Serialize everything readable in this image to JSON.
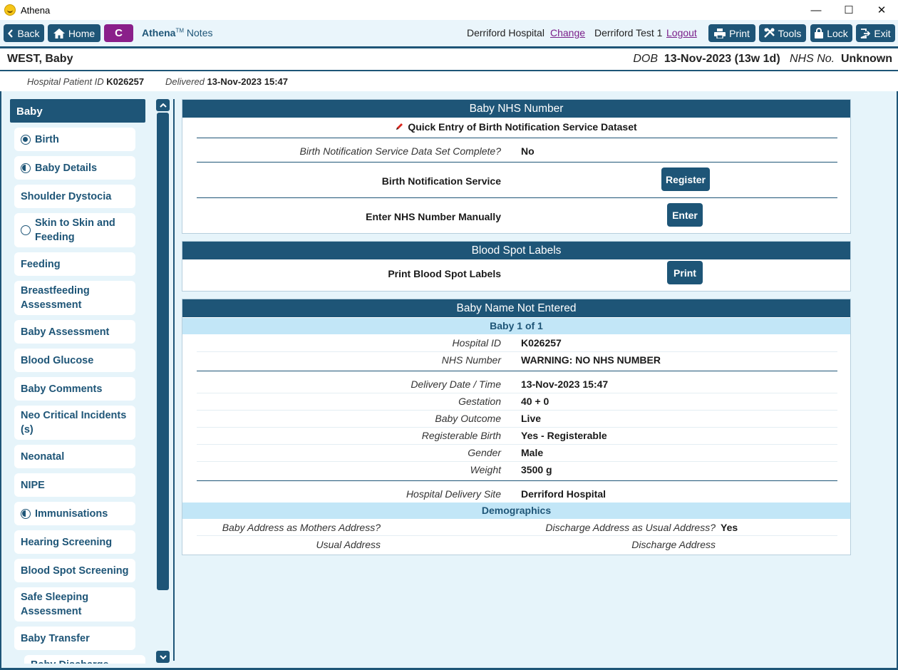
{
  "window": {
    "title": "Athena",
    "minimize": "—",
    "maximize": "☐",
    "close": "✕"
  },
  "toolbar": {
    "back": "Back",
    "home": "Home",
    "c": "C",
    "brand_name": "Athena",
    "brand_tm": "TM",
    "brand_suffix": "Notes",
    "hospital": "Derriford Hospital",
    "change": "Change",
    "user": "Derriford Test 1",
    "logout": "Logout",
    "print": "Print",
    "tools": "Tools",
    "lock": "Lock",
    "exit": "Exit"
  },
  "patient": {
    "name": "WEST, Baby",
    "dob_label": "DOB",
    "dob_value": "13-Nov-2023 (13w 1d)",
    "nhs_label": "NHS No.",
    "nhs_value": "Unknown",
    "hospital_id_label": "Hospital Patient ID",
    "hospital_id_value": "K026257",
    "delivered_label": "Delivered",
    "delivered_value": "13-Nov-2023 15:47"
  },
  "sidebar": {
    "header": "Baby",
    "items": [
      {
        "label": "Birth",
        "status": "full"
      },
      {
        "label": "Baby Details",
        "status": "half"
      },
      {
        "label": "Shoulder Dystocia",
        "status": "none"
      },
      {
        "label": "Skin to Skin and Feeding",
        "status": "empty"
      },
      {
        "label": "Feeding",
        "status": "none"
      },
      {
        "label": "Breastfeeding Assessment",
        "status": "none"
      },
      {
        "label": "Baby Assessment",
        "status": "none"
      },
      {
        "label": "Blood Glucose",
        "status": "none"
      },
      {
        "label": "Baby Comments",
        "status": "none"
      },
      {
        "label": "Neo Critical Incidents (s)",
        "status": "none"
      },
      {
        "label": "Neonatal",
        "status": "none"
      },
      {
        "label": "NIPE",
        "status": "none"
      },
      {
        "label": "Immunisations",
        "status": "half"
      },
      {
        "label": "Hearing Screening",
        "status": "none"
      },
      {
        "label": "Blood Spot Screening",
        "status": "none"
      },
      {
        "label": "Safe Sleeping Assessment",
        "status": "none"
      },
      {
        "label": "Baby Transfer",
        "status": "none"
      },
      {
        "label": "Baby Discharge",
        "status": "none"
      }
    ]
  },
  "nhs_panel": {
    "title": "Baby NHS Number",
    "quick_entry": "Quick Entry of Birth Notification Service Dataset",
    "dataset_complete_label": "Birth Notification Service Data Set Complete?",
    "dataset_complete_value": "No",
    "bns_label": "Birth Notification Service",
    "register_button": "Register",
    "manual_label": "Enter NHS Number Manually",
    "enter_button": "Enter"
  },
  "bloodspot_panel": {
    "title": "Blood Spot Labels",
    "print_label": "Print Blood Spot Labels",
    "print_button": "Print"
  },
  "baby_panel": {
    "title": "Baby Name Not Entered",
    "baby_count": "Baby 1 of  1",
    "hospital_id_label": "Hospital ID",
    "hospital_id_value": "K026257",
    "nhs_label": "NHS Number",
    "nhs_value": "WARNING: NO NHS NUMBER",
    "delivery_label": "Delivery Date / Time",
    "delivery_value": "13-Nov-2023 15:47",
    "gestation_label": "Gestation",
    "gestation_value": "40 + 0",
    "outcome_label": "Baby Outcome",
    "outcome_value": "Live",
    "registerable_label": "Registerable Birth",
    "registerable_value": "Yes - Registerable",
    "gender_label": "Gender",
    "gender_value": "Male",
    "weight_label": "Weight",
    "weight_value": "3500 g",
    "site_label": "Hospital Delivery Site",
    "site_value": "Derriford Hospital",
    "demographics": "Demographics",
    "baby_address_label": "Baby Address as Mothers Address?",
    "discharge_usual_label": "Discharge Address as Usual Address?",
    "discharge_usual_value": "Yes",
    "usual_address_label": "Usual Address",
    "discharge_address_label": "Discharge Address"
  },
  "colors": {
    "primary": "#1e5577",
    "accent_c": "#8a1f8a",
    "background": "#e6f4fa",
    "subhead": "#c2e6f7"
  }
}
